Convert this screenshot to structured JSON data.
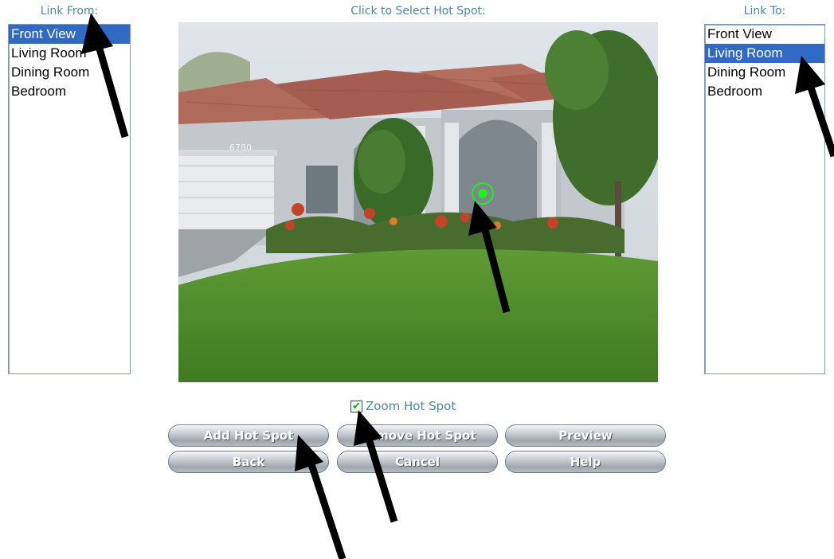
{
  "headings": {
    "link_from": "Link From:",
    "click_select": "Click to Select Hot Spot:",
    "link_to": "Link To:"
  },
  "link_from": {
    "options": [
      "Front View",
      "Living Room",
      "Dining Room",
      "Bedroom"
    ],
    "selected": "Front View"
  },
  "link_to": {
    "options": [
      "Front View",
      "Living Room",
      "Dining Room",
      "Bedroom"
    ],
    "selected": "Living Room"
  },
  "zoom_hot_spot": {
    "label": "Zoom Hot Spot",
    "checked": true
  },
  "buttons": {
    "add_hot_spot": "Add Hot Spot",
    "remove_hot_spot": "Remove Hot Spot",
    "preview": "Preview",
    "back": "Back",
    "cancel": "Cancel",
    "help": "Help"
  },
  "colors": {
    "heading": "#4a86a8",
    "selection": "#316ac5",
    "hot_spot": "#22ee22",
    "checkmark": "#21a121"
  },
  "photo": {
    "house_number": "6780"
  }
}
